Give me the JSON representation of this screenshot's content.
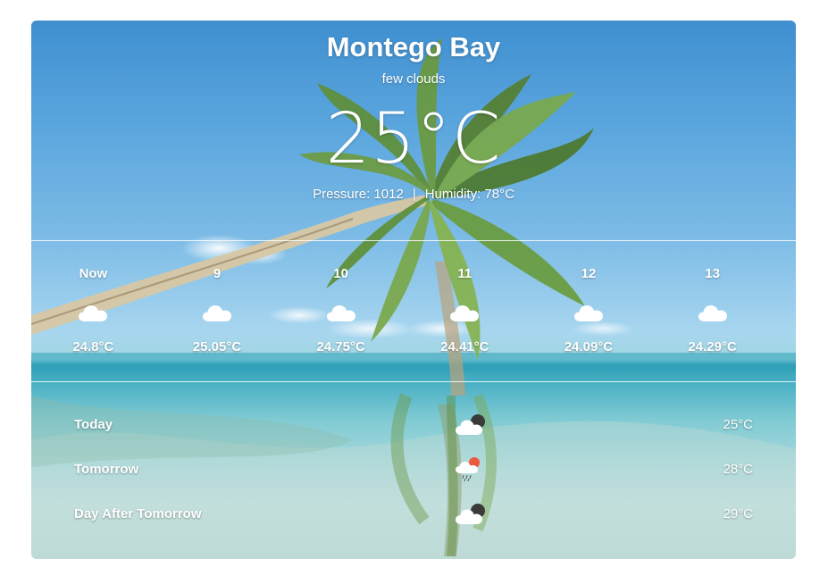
{
  "location": {
    "city": "Montego Bay",
    "description": "few clouds",
    "temperature": "25°C",
    "pressure": "Pressure: 1012",
    "separator": "|",
    "humidity": "Humidity: 78°C"
  },
  "hourly": [
    {
      "label": "Now",
      "icon": "cloud-icon",
      "temp": "24.8°C"
    },
    {
      "label": "9",
      "icon": "cloud-icon",
      "temp": "25.05°C"
    },
    {
      "label": "10",
      "icon": "cloud-icon",
      "temp": "24.75°C"
    },
    {
      "label": "11",
      "icon": "cloud-icon",
      "temp": "24.41°C"
    },
    {
      "label": "12",
      "icon": "cloud-icon",
      "temp": "24.09°C"
    },
    {
      "label": "13",
      "icon": "cloud-icon",
      "temp": "24.29°C"
    }
  ],
  "daily": [
    {
      "label": "Today",
      "icon": "cloudy-night-icon",
      "temp": "25°C"
    },
    {
      "label": "Tomorrow",
      "icon": "rain-sun-cloud-icon",
      "temp": "28°C"
    },
    {
      "label": "Day After Tomorrow",
      "icon": "cloudy-night-icon",
      "temp": "29°C"
    }
  ],
  "colors": {
    "text": "#ffffff",
    "divider": "#ffffff",
    "sky_top": "#3f8fd0",
    "sea": "#4fb3c6",
    "sun_accent": "#ef5a3c"
  }
}
